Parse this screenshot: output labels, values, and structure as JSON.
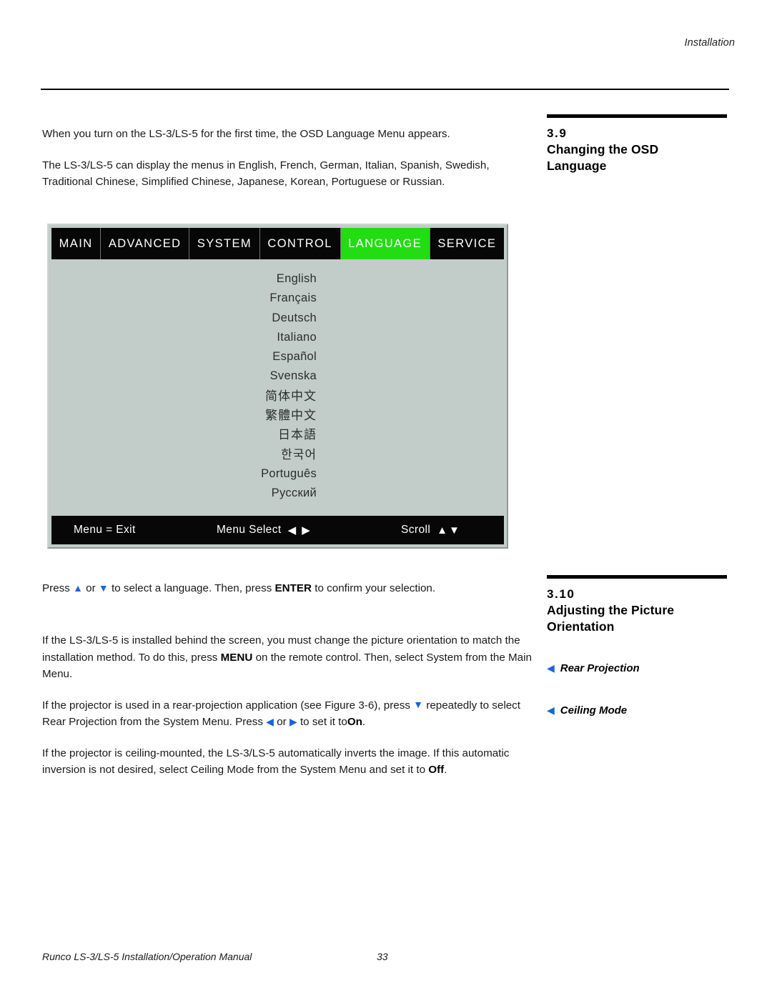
{
  "header": {
    "running_head": "Installation"
  },
  "body": {
    "intro_paragraph": "When you turn on the LS-3/LS-5 for the first time, the OSD Language Menu appears.",
    "languages_paragraph": "The LS-3/LS-5 can display the menus in English, French, German, Italian, Spanish, Swedish, Traditional Chinese, Simplified Chinese, Japanese, Korean, Portuguese or Russian.",
    "press_instruction": {
      "part1": "Press",
      "or": "or",
      "part2": "to select a language. Then, press",
      "enter": "ENTER",
      "part3": "to confirm your selection."
    },
    "orientation_paragraph": {
      "part1": "If the LS-3/LS-5 is installed behind the screen, you must change the picture orientation to match the installation method. To do this, press",
      "menu": "MENU",
      "part2": "on the remote control. Then, select System from the Main Menu."
    },
    "rear_projection_paragraph": {
      "part1": "If the projector is used in a rear-projection application (see Figure 3-6), press",
      "part2": "repeatedly to select Rear Projection from the System Menu. Press",
      "or": "or",
      "part3": "to set it to",
      "on": "On",
      "period": "."
    },
    "ceiling_paragraph": {
      "part1": "If the projector is ceiling-mounted, the LS-3/LS-5 automatically inverts the image.  If this automatic inversion is not desired, select Ceiling Mode from the System Menu and set it to",
      "off": "Off",
      "period": "."
    }
  },
  "sidebar": {
    "sections": [
      {
        "number": "3.9",
        "title_line1": "Changing the OSD",
        "title_line2": "Language"
      },
      {
        "number": "3.10",
        "title_line1": "Adjusting the Picture",
        "title_line2": "Orientation"
      }
    ],
    "margin_notes": [
      {
        "label": "Rear Projection"
      },
      {
        "label": "Ceiling Mode"
      }
    ]
  },
  "osd": {
    "tabs": [
      {
        "label": "MAIN",
        "active": false
      },
      {
        "label": "ADVANCED",
        "active": false
      },
      {
        "label": "SYSTEM",
        "active": false
      },
      {
        "label": "CONTROL",
        "active": false
      },
      {
        "label": "LANGUAGE",
        "active": true
      },
      {
        "label": "SERVICE",
        "active": false
      }
    ],
    "languages": [
      "English",
      "Français",
      "Deutsch",
      "Italiano",
      "Español",
      "Svenska",
      "简体中文",
      "繁體中文",
      "日本語",
      "한국어",
      "Português",
      "Русский"
    ],
    "footer": {
      "exit": "Menu = Exit",
      "select": "Menu Select",
      "select_glyphs": "◀ ▶",
      "scroll": "Scroll",
      "scroll_glyphs": "▲▼"
    },
    "colors": {
      "highlight": "#22dd11",
      "panel": "#c2ccc8",
      "bar": "#070707"
    }
  },
  "footer": {
    "manual_title": "Runco LS-3/LS-5 Installation/Operation Manual",
    "page_number": "33"
  }
}
